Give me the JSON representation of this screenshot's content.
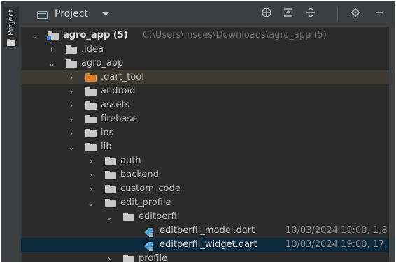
{
  "strip": {
    "label": "Project"
  },
  "header": {
    "title": "Project",
    "icons": [
      "locate-icon",
      "collapse-all-icon",
      "expand-all-icon",
      "gear-icon",
      "minimize-icon"
    ]
  },
  "tree": {
    "root": {
      "name": "agro_app (5)",
      "path": "C:\\Users\\msces\\Downloads\\agro_app (5)"
    },
    "idea": ".idea",
    "agro_app": "agro_app",
    "dart_tool": ".dart_tool",
    "android": "android",
    "assets": "assets",
    "firebase": "firebase",
    "ios": "ios",
    "lib": "lib",
    "auth": "auth",
    "backend": "backend",
    "custom_code": "custom_code",
    "edit_profile": "edit_profile",
    "editperfil": "editperfil",
    "file1": {
      "name": "editperfil_model.dart",
      "meta": "10/03/2024 19:00, 1,8"
    },
    "file2": {
      "name": "editperfil_widget.dart",
      "meta": "10/03/2024 19:00, 17,"
    },
    "profile": "profile"
  }
}
